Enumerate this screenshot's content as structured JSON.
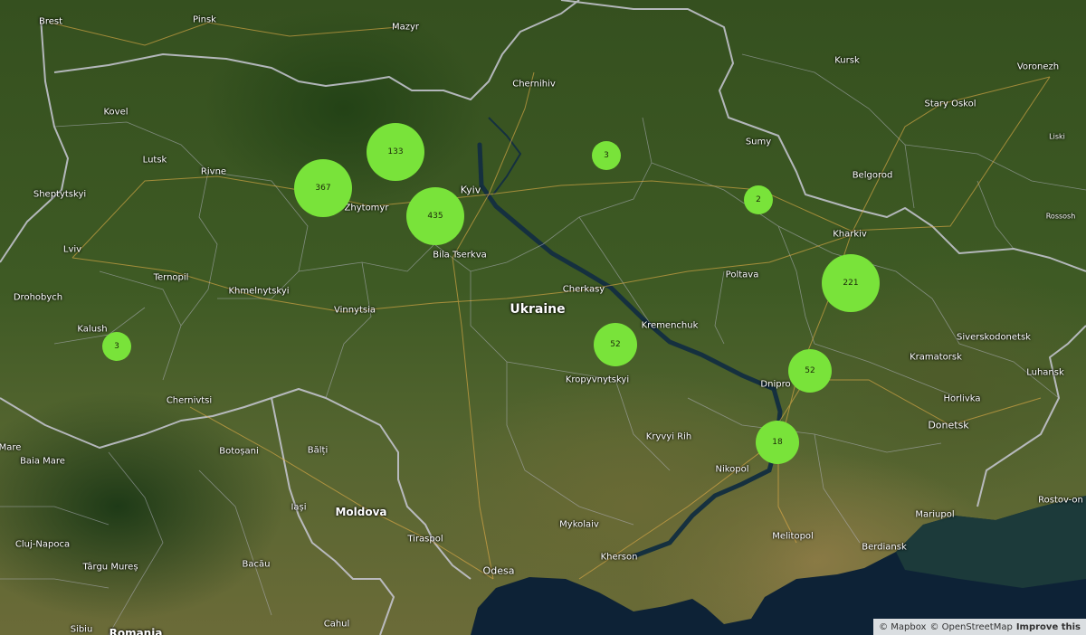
{
  "map": {
    "country_label": "Ukraine",
    "water_color": "#0d2236",
    "cluster_color": "#79e33a",
    "cities": [
      {
        "name": "Brest"
      },
      {
        "name": "Pinsk"
      },
      {
        "name": "Mazyr"
      },
      {
        "name": "Kursk"
      },
      {
        "name": "Voronezh"
      },
      {
        "name": "Chernihiv"
      },
      {
        "name": "Kovel"
      },
      {
        "name": "Lutsk"
      },
      {
        "name": "Rivne"
      },
      {
        "name": "Sheptytskyi"
      },
      {
        "name": "Zhytomyr"
      },
      {
        "name": "Kyiv"
      },
      {
        "name": "Sumy"
      },
      {
        "name": "Stary Oskol"
      },
      {
        "name": "Belgorod"
      },
      {
        "name": "Liski"
      },
      {
        "name": "Rossosh"
      },
      {
        "name": "Lviv"
      },
      {
        "name": "Bila Tserkva"
      },
      {
        "name": "Kharkiv"
      },
      {
        "name": "Ternopil"
      },
      {
        "name": "Drohobych"
      },
      {
        "name": "Khmelnytskyi"
      },
      {
        "name": "Poltava"
      },
      {
        "name": "Cherkasy"
      },
      {
        "name": "Vinnytsia"
      },
      {
        "name": "Kalush"
      },
      {
        "name": "Kremenchuk"
      },
      {
        "name": "Siverskodonetsk"
      },
      {
        "name": "Kramatorsk"
      },
      {
        "name": "Kropyvnytskyi"
      },
      {
        "name": "Dnipro"
      },
      {
        "name": "Luhansk"
      },
      {
        "name": "Chernivtsi"
      },
      {
        "name": "Horlivka"
      },
      {
        "name": "Donetsk"
      },
      {
        "name": "Mare"
      },
      {
        "name": "Botoșani"
      },
      {
        "name": "Bălți"
      },
      {
        "name": "Kryvyi Rih"
      },
      {
        "name": "Baia Mare"
      },
      {
        "name": "Nikopol"
      },
      {
        "name": "Rostov-on"
      },
      {
        "name": "Iași"
      },
      {
        "name": "Moldova"
      },
      {
        "name": "Mariupol"
      },
      {
        "name": "Mykolaiv"
      },
      {
        "name": "Melitopol"
      },
      {
        "name": "Tiraspol"
      },
      {
        "name": "Berdiansk"
      },
      {
        "name": "Cluj-Napoca"
      },
      {
        "name": "Kherson"
      },
      {
        "name": "Târgu Mureș"
      },
      {
        "name": "Bacău"
      },
      {
        "name": "Odesa"
      },
      {
        "name": "Sibiu"
      },
      {
        "name": "Cahul"
      },
      {
        "name": "Romania"
      }
    ],
    "clusters": [
      {
        "count": "133"
      },
      {
        "count": "367"
      },
      {
        "count": "435"
      },
      {
        "count": "3"
      },
      {
        "count": "2"
      },
      {
        "count": "221"
      },
      {
        "count": "3"
      },
      {
        "count": "52"
      },
      {
        "count": "52"
      },
      {
        "count": "18"
      }
    ]
  },
  "attribution": {
    "mapbox": "© Mapbox",
    "osm": "© OpenStreetMap",
    "improve": "Improve this"
  }
}
